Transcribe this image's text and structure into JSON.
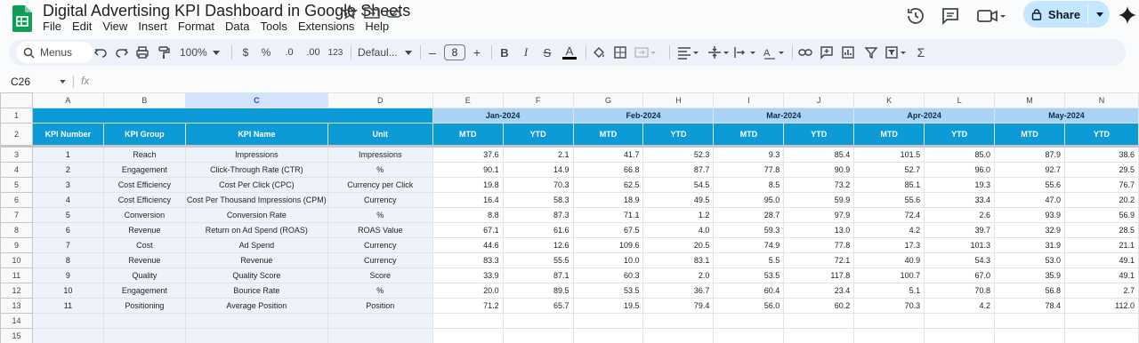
{
  "app": {
    "doc_title": "Digital Advertising KPI Dashboard in Google Sheets",
    "menu": [
      "File",
      "Edit",
      "View",
      "Insert",
      "Format",
      "Data",
      "Tools",
      "Extensions",
      "Help"
    ],
    "share_label": "Share",
    "colors": {
      "header_blue": "#0d9bd8",
      "month_blue": "#a9d3f5",
      "share_bg": "#c2e7ff",
      "sheets_green": "#0f9d58"
    }
  },
  "toolbar": {
    "menus_label": "Menus",
    "zoom": "100%",
    "currency": "$",
    "percent": "%",
    "dec_decrease": ".0",
    "dec_increase": ".00",
    "number_format": "123",
    "font": "Defaul...",
    "font_size": "8",
    "font_minus": "–",
    "font_plus": "+",
    "sum_icon": "Σ"
  },
  "formula_bar": {
    "cell_ref": "C26",
    "fx": "fx",
    "value": ""
  },
  "columns": [
    "A",
    "B",
    "C",
    "D",
    "E",
    "F",
    "G",
    "H",
    "I",
    "J",
    "K",
    "L",
    "M",
    "N"
  ],
  "row_numbers": [
    "1",
    "2",
    "3",
    "4",
    "5",
    "6",
    "7",
    "8",
    "9",
    "10",
    "11",
    "12",
    "13",
    "14",
    "15"
  ],
  "table": {
    "headers": [
      "KPI Number",
      "KPI Group",
      "KPI Name",
      "Unit"
    ],
    "months": [
      "Jan-2024",
      "Feb-2024",
      "Mar-2024",
      "Apr-2024",
      "May-2024"
    ],
    "subheaders": [
      "MTD",
      "YTD",
      "MTD",
      "YTD",
      "MTD",
      "YTD",
      "MTD",
      "YTD",
      "MTD",
      "YTD"
    ],
    "rows": [
      {
        "num": "1",
        "group": "Reach",
        "name": "Impressions",
        "unit": "Impressions",
        "v": [
          "37.6",
          "2.1",
          "41.7",
          "52.3",
          "9.3",
          "85.4",
          "101.5",
          "85.0",
          "87.9",
          "38.6"
        ]
      },
      {
        "num": "2",
        "group": "Engagement",
        "name": "Click-Through Rate (CTR)",
        "unit": "%",
        "v": [
          "90.1",
          "14.9",
          "66.8",
          "87.7",
          "77.8",
          "90.9",
          "52.7",
          "96.0",
          "92.7",
          "29.5"
        ]
      },
      {
        "num": "3",
        "group": "Cost Efficiency",
        "name": "Cost Per Click (CPC)",
        "unit": "Currency per Click",
        "v": [
          "19.8",
          "70.3",
          "62.5",
          "54.5",
          "8.5",
          "73.2",
          "85.1",
          "19.3",
          "55.6",
          "76.7"
        ]
      },
      {
        "num": "4",
        "group": "Cost Efficiency",
        "name": "Cost Per Thousand Impressions (CPM)",
        "unit": "Currency",
        "v": [
          "16.4",
          "58.3",
          "18.9",
          "49.5",
          "95.0",
          "59.9",
          "55.6",
          "33.4",
          "47.0",
          "20.2"
        ]
      },
      {
        "num": "5",
        "group": "Conversion",
        "name": "Conversion Rate",
        "unit": "%",
        "v": [
          "8.8",
          "87.3",
          "71.1",
          "1.2",
          "28.7",
          "97.9",
          "72.4",
          "2.6",
          "93.9",
          "56.9"
        ]
      },
      {
        "num": "6",
        "group": "Revenue",
        "name": "Return on Ad Spend (ROAS)",
        "unit": "ROAS Value",
        "v": [
          "67.1",
          "61.6",
          "67.5",
          "4.0",
          "59.3",
          "13.0",
          "4.2",
          "39.7",
          "32.9",
          "28.5"
        ]
      },
      {
        "num": "7",
        "group": "Cost",
        "name": "Ad Spend",
        "unit": "Currency",
        "v": [
          "44.6",
          "12.6",
          "109.6",
          "20.5",
          "74.9",
          "77.8",
          "17.3",
          "101.3",
          "31.9",
          "21.1"
        ]
      },
      {
        "num": "8",
        "group": "Revenue",
        "name": "Revenue",
        "unit": "Currency",
        "v": [
          "83.3",
          "55.5",
          "10.0",
          "83.1",
          "5.5",
          "72.1",
          "40.9",
          "54.3",
          "53.0",
          "49.1"
        ]
      },
      {
        "num": "9",
        "group": "Quality",
        "name": "Quality Score",
        "unit": "Score",
        "v": [
          "33.9",
          "87.1",
          "60.3",
          "2.0",
          "53.5",
          "117.8",
          "100.7",
          "67.0",
          "35.9",
          "49.1"
        ]
      },
      {
        "num": "10",
        "group": "Engagement",
        "name": "Bounce Rate",
        "unit": "%",
        "v": [
          "20.0",
          "89.5",
          "53.5",
          "36.7",
          "60.4",
          "23.4",
          "5.1",
          "70.8",
          "56.8",
          "2.7"
        ]
      },
      {
        "num": "11",
        "group": "Positioning",
        "name": "Average Position",
        "unit": "Position",
        "v": [
          "71.2",
          "65.7",
          "19.5",
          "79.4",
          "56.0",
          "60.2",
          "70.3",
          "4.2",
          "78.4",
          "112.0"
        ]
      }
    ]
  }
}
